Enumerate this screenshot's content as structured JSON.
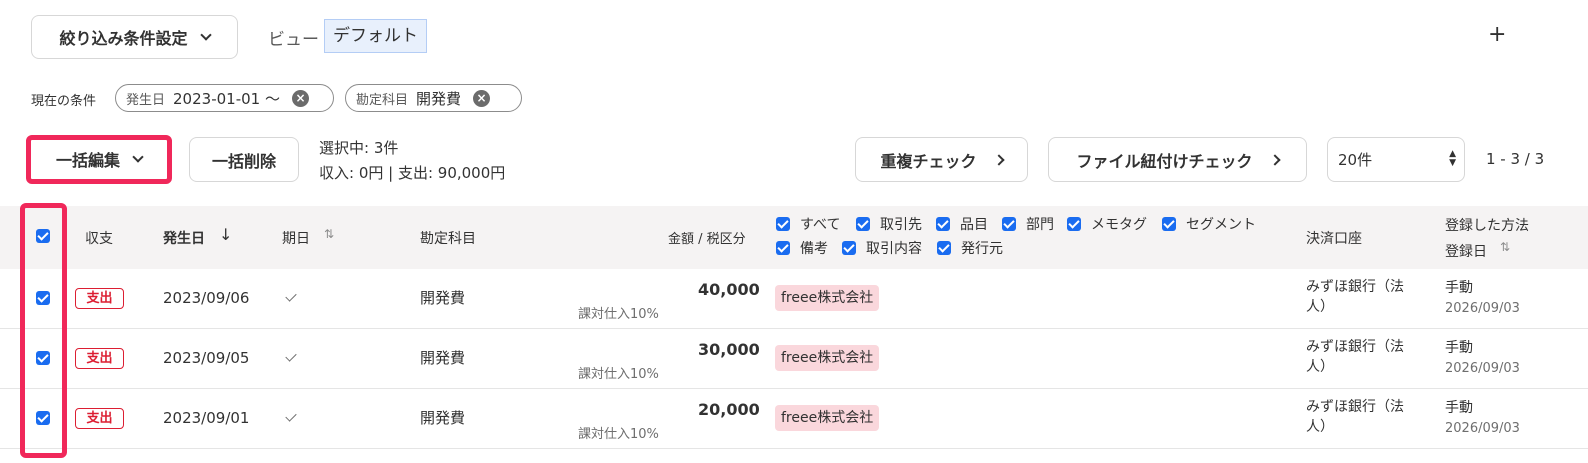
{
  "filter_button": {
    "label": "絞り込み条件設定"
  },
  "view": {
    "label": "ビュー",
    "value": "デフォルト"
  },
  "add_label": "+",
  "conditions": {
    "label": "現在の条件",
    "chips": [
      {
        "label": "発生日",
        "value": "2023-01-01 〜"
      },
      {
        "label": "勘定科目",
        "value": "開発費"
      }
    ]
  },
  "toolbar": {
    "bulk_edit": "一括編集",
    "bulk_delete": "一括削除",
    "selected": "選択中: 3件",
    "summary": "収入: 0円 | 支出: 90,000円",
    "dup_check": "重複チェック",
    "file_check": "ファイル紐付けチェック",
    "per_page": "20件",
    "pagination": "1 - 3 / 3"
  },
  "table": {
    "headers": {
      "type": "収支",
      "date": "発生日",
      "due": "期日",
      "account": "勘定科目",
      "amount": "金額 / 税区分",
      "payment": "決済口座",
      "method": "登録した方法",
      "reg_date": "登録日"
    },
    "column_toggles": [
      "すべて",
      "取引先",
      "品目",
      "部門",
      "メモタグ",
      "セグメント",
      "備考",
      "取引内容",
      "発行元"
    ],
    "rows": [
      {
        "type": "支出",
        "date": "2023/09/06",
        "account": "開発費",
        "amount": "40,000",
        "tax": "課対仕入10%",
        "partner": "freee株式会社",
        "payment": "みずほ銀行（法人）",
        "method": "手動",
        "reg_date": "2026/09/03"
      },
      {
        "type": "支出",
        "date": "2023/09/05",
        "account": "開発費",
        "amount": "30,000",
        "tax": "課対仕入10%",
        "partner": "freee株式会社",
        "payment": "みずほ銀行（法人）",
        "method": "手動",
        "reg_date": "2026/09/03"
      },
      {
        "type": "支出",
        "date": "2023/09/01",
        "account": "開発費",
        "amount": "20,000",
        "tax": "課対仕入10%",
        "partner": "freee株式会社",
        "payment": "みずほ銀行（法人）",
        "method": "手動",
        "reg_date": "2026/09/03"
      }
    ]
  },
  "colors": {
    "accent": "#1a6cf0",
    "highlight": "#f0285a",
    "expense": "#dc1e32",
    "partner_bg": "#fad7dc"
  }
}
